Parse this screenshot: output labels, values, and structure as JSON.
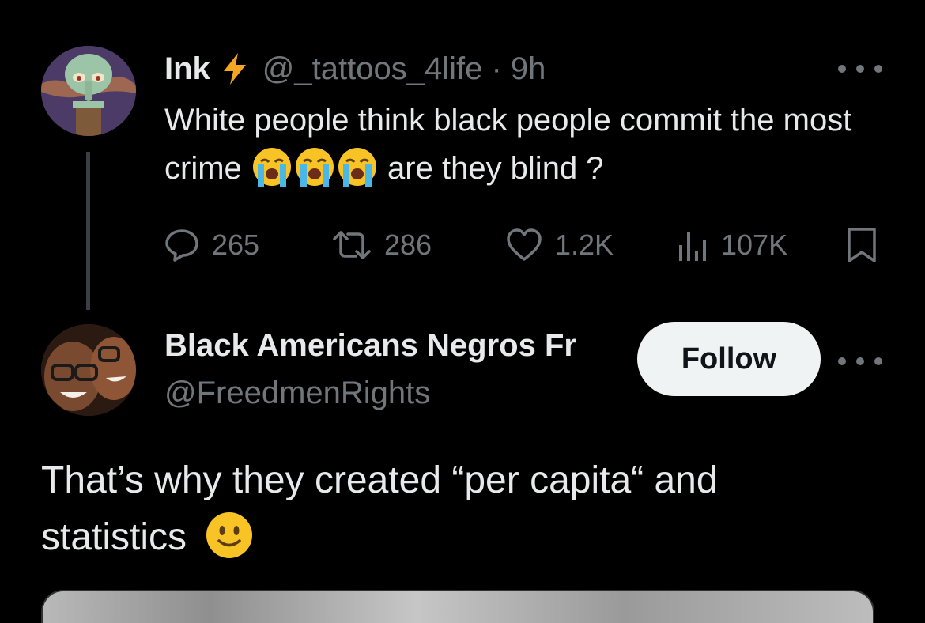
{
  "parent_tweet": {
    "author_name": "Ink",
    "handle_time": "@_tattoos_4life · 9h",
    "text_before_emoji": "White people think black people commit the most crime",
    "text_after_emoji": "are they blind ?",
    "emojis": [
      "loudly-crying-face",
      "loudly-crying-face",
      "loudly-crying-face"
    ],
    "badge_icon": "lightning-bolt-icon",
    "badge_color": "#f5a623",
    "stats": {
      "replies": "265",
      "retweets": "286",
      "likes": "1.2K",
      "views": "107K"
    }
  },
  "reply_tweet": {
    "author_name": "Black Americans Negros Fr",
    "handle": "@FreedmenRights",
    "follow_label": "Follow",
    "text": "That’s why they created “per capita“ and statistics",
    "emoji": "slightly-smiling-face"
  },
  "colors": {
    "background": "#000000",
    "primary_text": "#e7e9ea",
    "secondary_text": "#71767b",
    "follow_bg": "#eff3f4",
    "emoji_yellow": "#f7c325"
  }
}
